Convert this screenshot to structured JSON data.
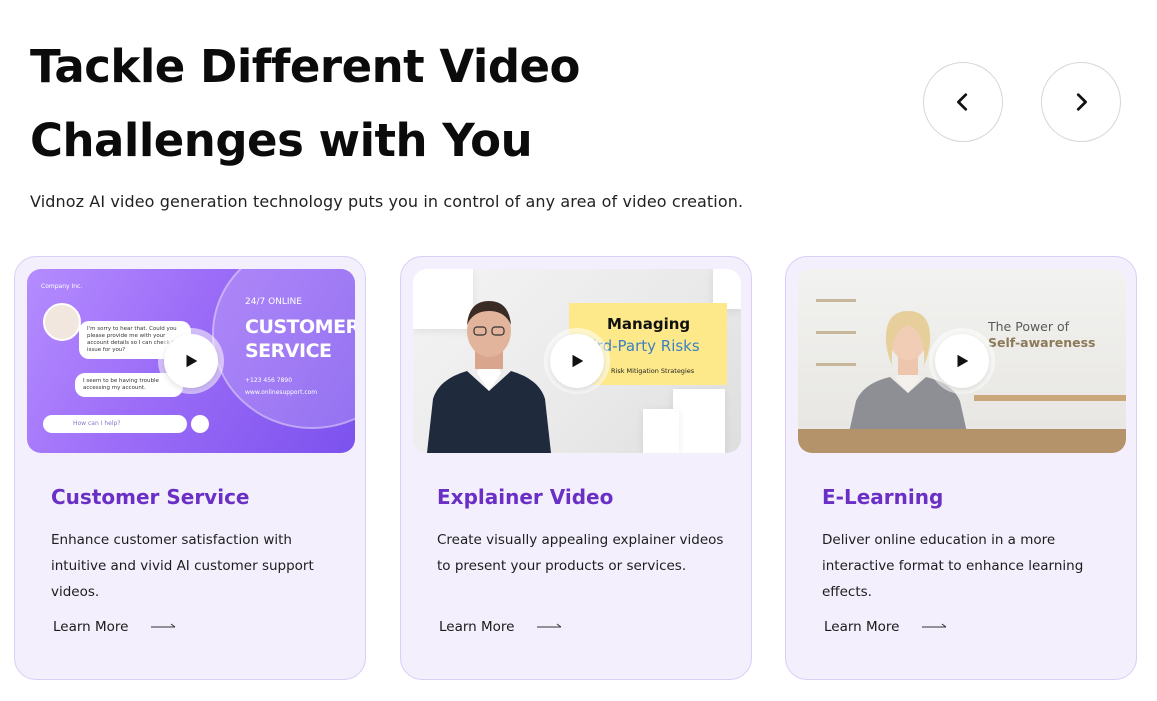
{
  "header": {
    "title_line1": "Tackle Different Video",
    "title_line2": "Challenges with You",
    "subtitle": "Vidnoz AI video generation technology puts you in control of any area of video creation."
  },
  "nav": {
    "prev_icon": "chevron-left-icon",
    "next_icon": "chevron-right-icon"
  },
  "colors": {
    "accent": "#6a2fc4",
    "card_bg": "#f3effd",
    "card_border": "#dccdf6"
  },
  "cards": [
    {
      "title": "Customer Service",
      "description": "Enhance customer satisfaction with intuitive and vivid AI customer support videos.",
      "cta": "Learn More",
      "thumb": {
        "brand": "Company Inc.",
        "online": "24/7 ONLINE",
        "headline_1": "CUSTOMER",
        "headline_2": "SERVICE",
        "phone": "+123 456 7890",
        "site": "www.onlinesupport.com",
        "bubble_1": "I'm sorry to hear that. Could you please provide me with your account details so I can check the issue for you?",
        "bubble_2": "I seem to be having trouble accessing my account.",
        "ask": "How can I help?"
      }
    },
    {
      "title": "Explainer Video",
      "description": "Create visually appealing explainer videos to present your products or services.",
      "cta": "Learn More",
      "thumb": {
        "sign_1": "Managing",
        "sign_2": "hird-Party Risks",
        "sign_3": "Risk Mitigation Strategies"
      }
    },
    {
      "title": "E-Learning",
      "description": "Deliver online education in a more interactive format to enhance learning effects.",
      "cta": "Learn More",
      "thumb": {
        "wall_1": "The Power of",
        "wall_2": "Self-awareness"
      }
    }
  ]
}
